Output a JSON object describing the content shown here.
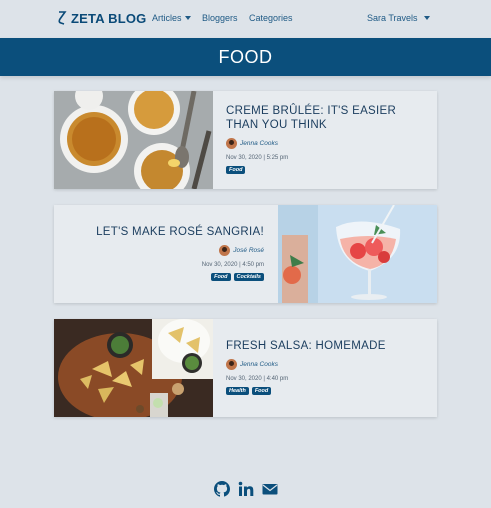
{
  "nav": {
    "brand": "ZETA BLOG",
    "articles": "Articles",
    "bloggers": "Bloggers",
    "categories": "Categories",
    "user": "Sara Travels"
  },
  "hero": {
    "title": "FOOD"
  },
  "posts": [
    {
      "title": "CREME BRÛLÉE: IT'S EASIER THAN YOU THINK",
      "author": "Jenna Cooks",
      "date": "Nov 30, 2020 | 5:25 pm",
      "tags": [
        "Food"
      ]
    },
    {
      "title": "LET'S MAKE ROSÉ SANGRIA!",
      "author": "José Rosé",
      "date": "Nov 30, 2020 | 4:50 pm",
      "tags": [
        "Food",
        "Cocktails"
      ]
    },
    {
      "title": "FRESH SALSA: HOMEMADE",
      "author": "Jenna Cooks",
      "date": "Nov 30, 2020 | 4:40 pm",
      "tags": [
        "Health",
        "Food"
      ]
    }
  ],
  "footer": {
    "icons": [
      "github-icon",
      "linkedin-icon",
      "envelope-icon"
    ]
  },
  "colors": {
    "primary": "#0b4f7c",
    "background": "#dde3e9",
    "card": "#e7ebef"
  }
}
